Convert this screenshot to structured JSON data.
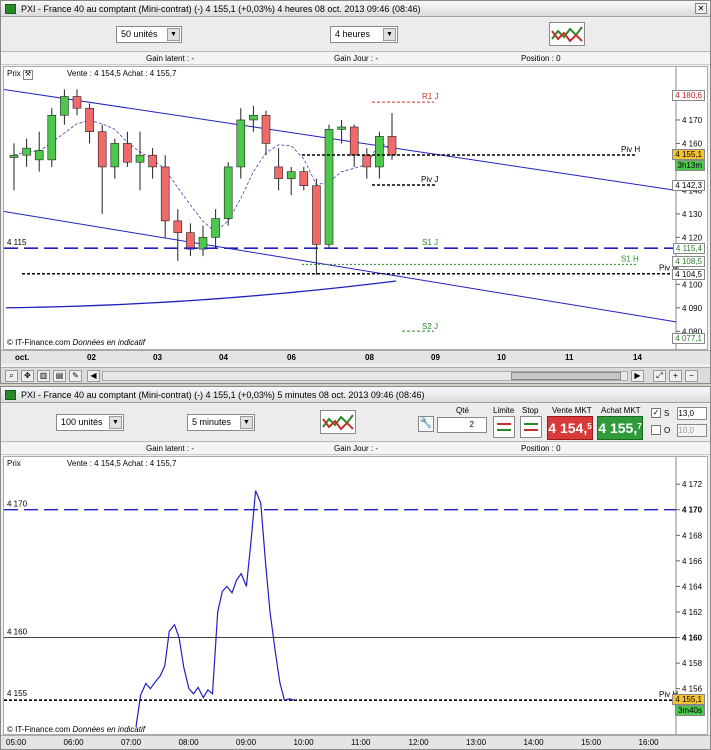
{
  "top": {
    "title": "PXI - France 40 au comptant (Mini-contrat)  (-)   4 155,1 (+0,03%)    4 heures   08 oct. 2013 09:46 (08:46)",
    "units": "50 unités",
    "timeframe": "4 heures",
    "gain_latent": "Gain latent : -",
    "gain_jour": "Gain Jour : -",
    "position": "Position : 0",
    "legend_prix": "Prix",
    "legend_quotes": "Vente : 4 154,5 Achat : 4 155,7",
    "source": "© IT-Finance.com",
    "source_note": "Données en indicatif",
    "dates": [
      "oct.",
      "02",
      "03",
      "04",
      "06",
      "08",
      "09",
      "10",
      "11",
      "14"
    ],
    "y_ticks": [
      "4 170",
      "4 160",
      "4 150",
      "4 140",
      "4 130",
      "4 120",
      "4 110",
      "4 100",
      "4 090",
      "4 080"
    ],
    "left_level": "4 115",
    "levels": {
      "r1": "R1 J",
      "pivh": "Piv H",
      "pivj": "Piv J",
      "s1j": "S1 J",
      "s1h": "S1 H",
      "pivm": "Piv M",
      "s2j": "S2 J"
    },
    "boxes": {
      "r1": "4 180,6",
      "last": "4 155,1",
      "countdown": "3h13m",
      "pivj": "4 142,3",
      "s1j": "4 115,4",
      "s1h": "4 108,5",
      "pivm": "4 104,5",
      "s2j": "4 077,1"
    }
  },
  "bottom": {
    "title": "PXI - France 40 au comptant (Mini-contrat)  (-)   4 155,1 (+0,03%)    5 minutes   08 oct. 2013 09:46 (08:46)",
    "units": "100 unités",
    "timeframe": "5 minutes",
    "qte_label": "Qté",
    "qte_value": "2",
    "limite_label": "Limite",
    "stop_label": "Stop",
    "vente_label": "Vente MKT",
    "achat_label": "Achat MKT",
    "vente_big": "4 154,",
    "vente_small": "5",
    "achat_big": "4 155,",
    "achat_small": "7",
    "s_label": "S",
    "s_value": "13,0",
    "o_label": "O",
    "o_value": "10,0",
    "gain_latent": "Gain latent : -",
    "gain_jour": "Gain Jour : -",
    "position": "Position : 0",
    "legend_prix": "Prix",
    "legend_quotes": "Vente : 4 154,5 Achat : 4 155,7",
    "source": "© IT-Finance.com",
    "source_note": "Données en indicatif",
    "times": [
      "05:00",
      "06:00",
      "07:00",
      "08:00",
      "09:00",
      "10:00",
      "11:00",
      "12:00",
      "13:00",
      "14:00",
      "15:00",
      "16:00"
    ],
    "y_ticks": [
      "4 172",
      "4 170",
      "4 168",
      "4 166",
      "4 164",
      "4 162",
      "4 160",
      "4 158",
      "4 156"
    ],
    "left_levels": [
      "4 170",
      "4 160",
      "4 155"
    ],
    "pivh": "Piv H",
    "last": "4 155,1",
    "countdown": "3m40s"
  },
  "chart_data": [
    {
      "type": "candlestick",
      "title": "PXI - France 40 au comptant (Mini-contrat)",
      "timeframe": "4 heures",
      "ylim": [
        4075,
        4190
      ],
      "x_ticks": [
        "oct.",
        "02",
        "03",
        "04",
        "06",
        "08",
        "09",
        "10",
        "11",
        "14"
      ],
      "candles": [
        {
          "o": 4154,
          "h": 4160,
          "l": 4140,
          "c": 4155
        },
        {
          "o": 4155,
          "h": 4162,
          "l": 4150,
          "c": 4158
        },
        {
          "o": 4153,
          "h": 4165,
          "l": 4148,
          "c": 4157
        },
        {
          "o": 4153,
          "h": 4175,
          "l": 4150,
          "c": 4172
        },
        {
          "o": 4172,
          "h": 4183,
          "l": 4168,
          "c": 4180
        },
        {
          "o": 4180,
          "h": 4183,
          "l": 4172,
          "c": 4175
        },
        {
          "o": 4175,
          "h": 4177,
          "l": 4160,
          "c": 4165
        },
        {
          "o": 4165,
          "h": 4168,
          "l": 4130,
          "c": 4150
        },
        {
          "o": 4150,
          "h": 4162,
          "l": 4145,
          "c": 4160
        },
        {
          "o": 4160,
          "h": 4165,
          "l": 4150,
          "c": 4152
        },
        {
          "o": 4152,
          "h": 4165,
          "l": 4140,
          "c": 4155
        },
        {
          "o": 4155,
          "h": 4158,
          "l": 4145,
          "c": 4150
        },
        {
          "o": 4150,
          "h": 4155,
          "l": 4120,
          "c": 4127
        },
        {
          "o": 4127,
          "h": 4132,
          "l": 4110,
          "c": 4122
        },
        {
          "o": 4122,
          "h": 4126,
          "l": 4112,
          "c": 4115
        },
        {
          "o": 4115,
          "h": 4125,
          "l": 4112,
          "c": 4120
        },
        {
          "o": 4120,
          "h": 4132,
          "l": 4115,
          "c": 4128
        },
        {
          "o": 4128,
          "h": 4152,
          "l": 4125,
          "c": 4150
        },
        {
          "o": 4150,
          "h": 4175,
          "l": 4145,
          "c": 4170
        },
        {
          "o": 4170,
          "h": 4176,
          "l": 4165,
          "c": 4172
        },
        {
          "o": 4172,
          "h": 4174,
          "l": 4155,
          "c": 4160
        },
        {
          "o": 4150,
          "h": 4158,
          "l": 4140,
          "c": 4145
        },
        {
          "o": 4145,
          "h": 4150,
          "l": 4138,
          "c": 4148
        },
        {
          "o": 4148,
          "h": 4150,
          "l": 4140,
          "c": 4142
        },
        {
          "o": 4142,
          "h": 4145,
          "l": 4104,
          "c": 4117
        },
        {
          "o": 4117,
          "h": 4168,
          "l": 4115,
          "c": 4166
        },
        {
          "o": 4166,
          "h": 4170,
          "l": 4160,
          "c": 4167
        },
        {
          "o": 4167,
          "h": 4168,
          "l": 4150,
          "c": 4155
        },
        {
          "o": 4155,
          "h": 4158,
          "l": 4145,
          "c": 4150
        },
        {
          "o": 4150,
          "h": 4165,
          "l": 4145,
          "c": 4163
        },
        {
          "o": 4163,
          "h": 4173,
          "l": 4153,
          "c": 4155
        }
      ],
      "levels": [
        {
          "name": "R1 J",
          "value": 4180.6
        },
        {
          "name": "Piv H",
          "value": 4155.1
        },
        {
          "name": "Piv J",
          "value": 4142.3
        },
        {
          "name": "S1 J",
          "value": 4115.4
        },
        {
          "name": "S1 H",
          "value": 4108.5
        },
        {
          "name": "Piv M",
          "value": 4104.5
        },
        {
          "name": "S2 J",
          "value": 4077.1
        }
      ]
    },
    {
      "type": "line",
      "title": "PXI - France 40 au comptant (Mini-contrat)",
      "timeframe": "5 minutes",
      "ylim": [
        4153,
        4173.5
      ],
      "x_ticks": [
        "05:00",
        "06:00",
        "07:00",
        "08:00",
        "09:00",
        "10:00",
        "11:00",
        "12:00",
        "13:00",
        "14:00",
        "15:00",
        "16:00"
      ],
      "x_hours": [
        7.0,
        7.08,
        7.17,
        7.25,
        7.33,
        7.42,
        7.5,
        7.58,
        7.67,
        7.75,
        7.83,
        7.92,
        8.0,
        8.08,
        8.17,
        8.25,
        8.33,
        8.42,
        8.5,
        8.58,
        8.67,
        8.75,
        8.83,
        8.92,
        9.0,
        9.08,
        9.17,
        9.25,
        9.33,
        9.42,
        9.5,
        9.58,
        9.67,
        9.75
      ],
      "values": [
        4153.0,
        4155.5,
        4156.4,
        4156.0,
        4156.5,
        4157.0,
        4157.8,
        4160.5,
        4161.0,
        4160.0,
        4157.7,
        4156.0,
        4155.6,
        4156.1,
        4155.3,
        4155.9,
        4155.6,
        4162.0,
        4163.6,
        4164.0,
        4163.5,
        4164.5,
        4165.0,
        4164.0,
        4167.5,
        4171.5,
        4170.5,
        4166.0,
        4162.0,
        4159.0,
        4156.5,
        4155.1,
        4155.2,
        4155.1
      ],
      "levels": [
        {
          "name": "",
          "value": 4170
        },
        {
          "name": "",
          "value": 4160
        },
        {
          "name": "Piv H",
          "value": 4155.1
        }
      ]
    }
  ]
}
